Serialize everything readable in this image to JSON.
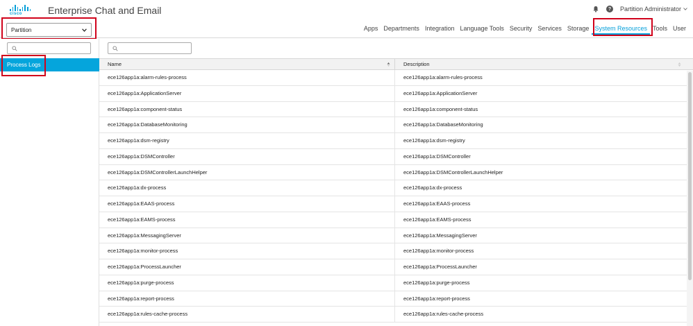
{
  "header": {
    "logo_text": "cisco",
    "app_title": "Enterprise Chat and Email",
    "user": "Partition Administrator"
  },
  "partition_select": {
    "value": "Partition"
  },
  "nav": {
    "items": [
      {
        "label": "Apps",
        "active": false
      },
      {
        "label": "Departments",
        "active": false
      },
      {
        "label": "Integration",
        "active": false
      },
      {
        "label": "Language Tools",
        "active": false
      },
      {
        "label": "Security",
        "active": false
      },
      {
        "label": "Services",
        "active": false
      },
      {
        "label": "Storage",
        "active": false
      },
      {
        "label": "System Resources",
        "active": true
      },
      {
        "label": "Tools",
        "active": false
      },
      {
        "label": "User",
        "active": false
      }
    ]
  },
  "sidebar": {
    "search_placeholder": "",
    "items": [
      {
        "label": "Process Logs",
        "selected": true
      }
    ]
  },
  "main": {
    "search_placeholder": "",
    "table": {
      "columns": [
        "Name",
        "Description"
      ],
      "rows": [
        [
          "ece126app1a:alarm-rules-process",
          "ece126app1a:alarm-rules-process"
        ],
        [
          "ece126app1a:ApplicationServer",
          "ece126app1a:ApplicationServer"
        ],
        [
          "ece126app1a:component-status",
          "ece126app1a:component-status"
        ],
        [
          "ece126app1a:DatabaseMonitoring",
          "ece126app1a:DatabaseMonitoring"
        ],
        [
          "ece126app1a:dsm-registry",
          "ece126app1a:dsm-registry"
        ],
        [
          "ece126app1a:DSMController",
          "ece126app1a:DSMController"
        ],
        [
          "ece126app1a:DSMControllerLaunchHelper",
          "ece126app1a:DSMControllerLaunchHelper"
        ],
        [
          "ece126app1a:dx-process",
          "ece126app1a:dx-process"
        ],
        [
          "ece126app1a:EAAS-process",
          "ece126app1a:EAAS-process"
        ],
        [
          "ece126app1a:EAMS-process",
          "ece126app1a:EAMS-process"
        ],
        [
          "ece126app1a:MessagingServer",
          "ece126app1a:MessagingServer"
        ],
        [
          "ece126app1a:monitor-process",
          "ece126app1a:monitor-process"
        ],
        [
          "ece126app1a:ProcessLauncher",
          "ece126app1a:ProcessLauncher"
        ],
        [
          "ece126app1a:purge-process",
          "ece126app1a:purge-process"
        ],
        [
          "ece126app1a:report-process",
          "ece126app1a:report-process"
        ],
        [
          "ece126app1a:rules-cache-process",
          "ece126app1a:rules-cache-process"
        ]
      ]
    }
  },
  "colors": {
    "accent": "#049fd9",
    "highlight_box": "#d0021b",
    "selected_bg": "#05a5dc"
  },
  "icons": [
    "bell-icon",
    "help-icon",
    "chevron-down-icon",
    "search-icon",
    "sort-icon"
  ]
}
